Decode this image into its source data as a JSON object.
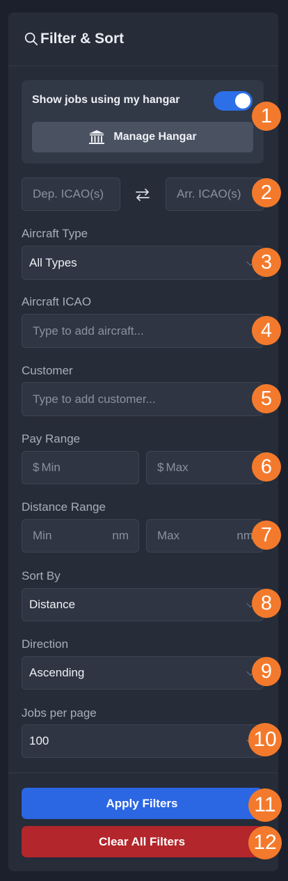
{
  "header": {
    "title": "Filter & Sort",
    "icon": "search-icon"
  },
  "hangar": {
    "toggle_label": "Show jobs using my hangar",
    "toggle_on": true,
    "manage_label": "Manage Hangar",
    "manage_icon": "hangar-building-icon"
  },
  "route": {
    "dep_placeholder": "Dep. ICAO(s)",
    "arr_placeholder": "Arr. ICAO(s)",
    "swap_icon": "swap-arrows-icon"
  },
  "aircraft_type": {
    "label": "Aircraft Type",
    "value": "All Types"
  },
  "aircraft_icao": {
    "label": "Aircraft ICAO",
    "placeholder": "Type to add aircraft..."
  },
  "customer": {
    "label": "Customer",
    "placeholder": "Type to add customer..."
  },
  "pay_range": {
    "label": "Pay Range",
    "currency": "$",
    "min_placeholder": "Min",
    "max_placeholder": "Max"
  },
  "distance_range": {
    "label": "Distance Range",
    "min_placeholder": "Min",
    "max_placeholder": "Max",
    "unit": "nm"
  },
  "sort_by": {
    "label": "Sort By",
    "value": "Distance"
  },
  "direction": {
    "label": "Direction",
    "value": "Ascending"
  },
  "jobs_per_page": {
    "label": "Jobs per page",
    "value": "100"
  },
  "actions": {
    "apply_label": "Apply Filters",
    "clear_label": "Clear All Filters"
  },
  "badges": [
    "1",
    "2",
    "3",
    "4",
    "5",
    "6",
    "7",
    "8",
    "9",
    "10",
    "11",
    "12"
  ],
  "colors": {
    "accent": "#2b66e3",
    "danger": "#b3262b",
    "badge": "#f37a2c",
    "panel": "#262c38"
  }
}
